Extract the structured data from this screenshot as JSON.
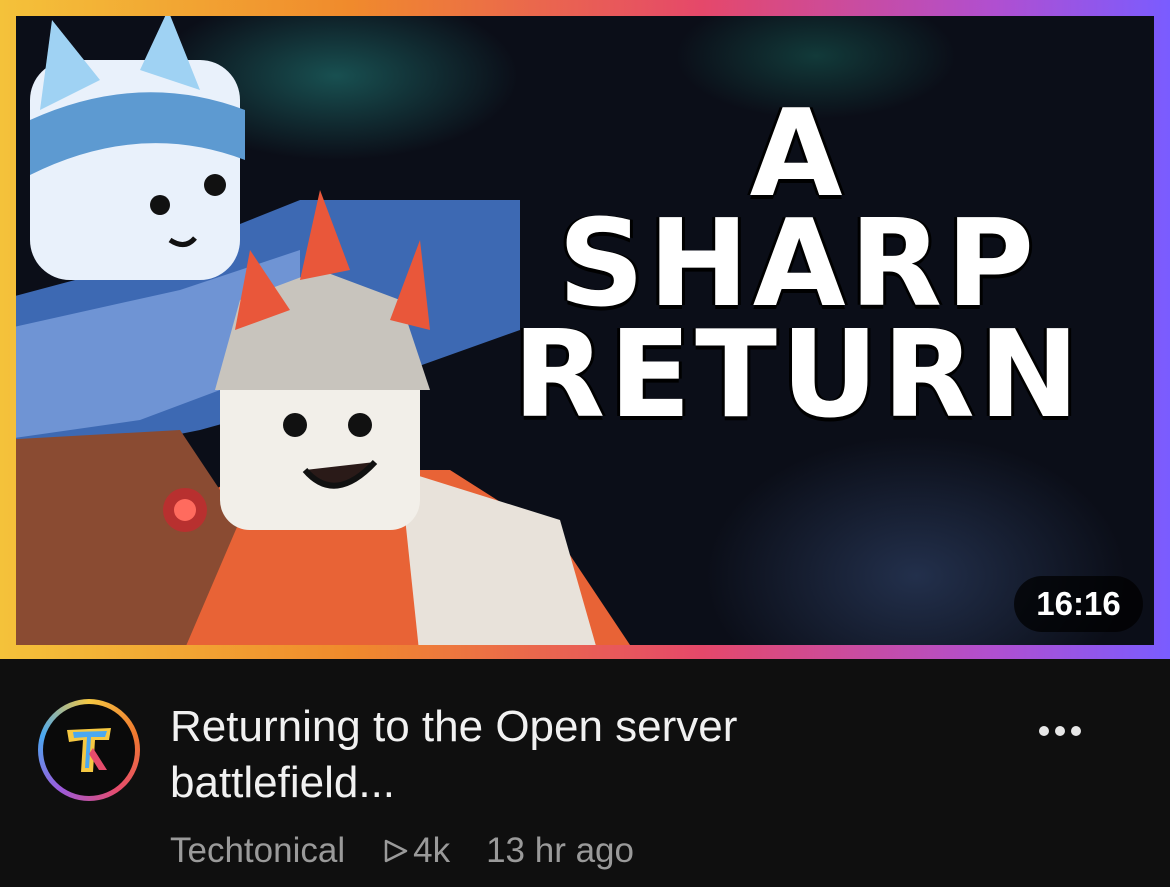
{
  "thumbnail": {
    "headline_lines": [
      "A",
      "SHARP",
      "RETURN"
    ],
    "duration": "16:16",
    "border_colors": [
      "#f4c23a",
      "#f08a2c",
      "#e5486a",
      "#b04fd0",
      "#7a5cff"
    ]
  },
  "video": {
    "title_line1": "Returning to the Open server",
    "title_line2": "battlefield...",
    "channel": "Techtonical",
    "views": "4k",
    "age": "13 hr ago"
  },
  "icons": {
    "views": "play-triangle-outline-icon",
    "more": "more-options-icon",
    "avatar": "channel-logo"
  }
}
